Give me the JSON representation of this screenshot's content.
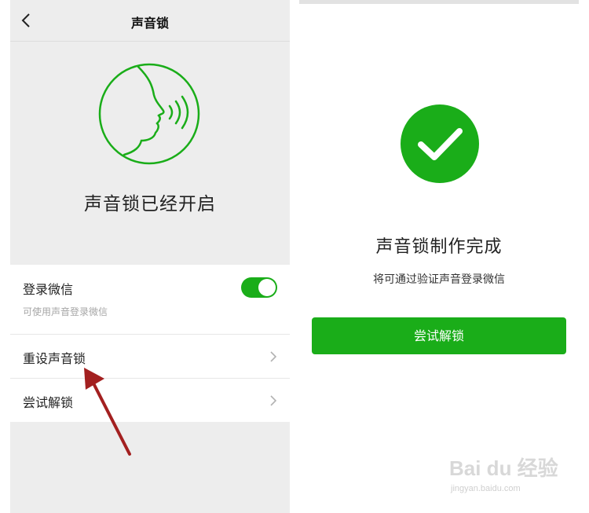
{
  "left": {
    "nav": {
      "title": "声音锁",
      "back_icon": "chevron-left-icon"
    },
    "status_text": "声音锁已经开启",
    "face_icon": "voice-face-icon",
    "settings": {
      "login": {
        "label": "登录微信",
        "sub": "可使用声音登录微信",
        "toggle_on": true
      },
      "reset": {
        "label": "重设声音锁"
      },
      "try_unlock": {
        "label": "尝试解锁"
      }
    },
    "accent_color": "#1aad19",
    "annotation_arrow_color": "#a32020"
  },
  "right": {
    "success_icon": "check-circle-icon",
    "title": "声音锁制作完成",
    "description": "将可通过验证声音登录微信",
    "button_label": "尝试解锁",
    "accent_color": "#1aad19"
  },
  "watermark": {
    "logo": "Bai du 经验",
    "url": "jingyan.baidu.com"
  }
}
